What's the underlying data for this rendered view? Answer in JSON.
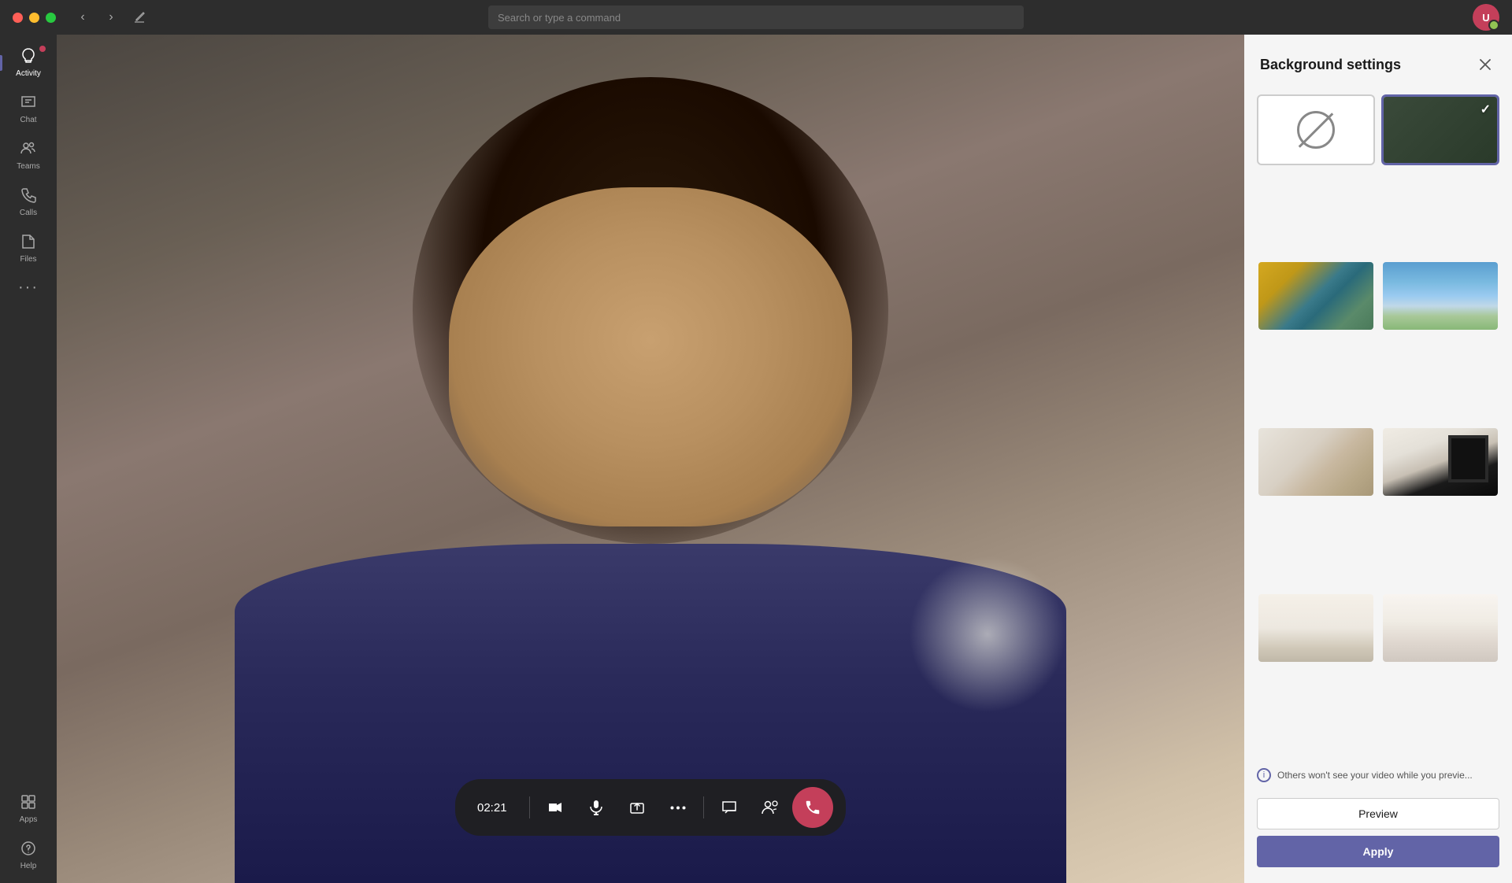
{
  "titlebar": {
    "search_placeholder": "Search or type a command",
    "traffic_lights": [
      "red",
      "yellow",
      "green"
    ]
  },
  "sidebar": {
    "items": [
      {
        "label": "Activity",
        "icon": "🔔",
        "active": true
      },
      {
        "label": "Chat",
        "icon": "💬",
        "active": false
      },
      {
        "label": "Teams",
        "icon": "👥",
        "active": false
      },
      {
        "label": "Calls",
        "icon": "📞",
        "active": false
      },
      {
        "label": "Files",
        "icon": "📁",
        "active": false
      },
      {
        "label": "...",
        "icon": "···",
        "active": false
      }
    ],
    "bottom_items": [
      {
        "label": "Apps",
        "icon": "⊞",
        "active": false
      },
      {
        "label": "Help",
        "icon": "?",
        "active": false
      }
    ]
  },
  "call": {
    "timer": "02:21",
    "controls": [
      {
        "name": "camera",
        "icon": "📹"
      },
      {
        "name": "microphone",
        "icon": "🎤"
      },
      {
        "name": "share",
        "icon": "⬆"
      },
      {
        "name": "more",
        "icon": "···"
      },
      {
        "name": "chat",
        "icon": "💬"
      },
      {
        "name": "participants",
        "icon": "👥"
      },
      {
        "name": "end-call",
        "icon": "📵"
      }
    ]
  },
  "background_panel": {
    "title": "Background settings",
    "info_text": "Others won't see your video while you previe...",
    "preview_label": "Preview",
    "apply_label": "Apply",
    "backgrounds": [
      {
        "id": "none",
        "type": "none",
        "selected": false
      },
      {
        "id": "dark-solid",
        "type": "dark-solid",
        "selected": true
      },
      {
        "id": "office",
        "type": "office",
        "selected": false
      },
      {
        "id": "outdoor",
        "type": "outdoor",
        "selected": false
      },
      {
        "id": "interior1",
        "type": "interior1",
        "selected": false
      },
      {
        "id": "interior2",
        "type": "interior2",
        "selected": false
      },
      {
        "id": "modern1",
        "type": "modern1",
        "selected": false
      },
      {
        "id": "modern2",
        "type": "modern2",
        "selected": false
      }
    ]
  }
}
